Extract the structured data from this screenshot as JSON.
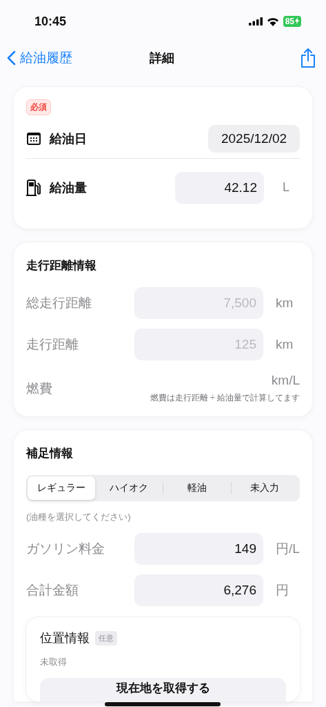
{
  "status_bar": {
    "time": "10:45",
    "battery": "85"
  },
  "nav": {
    "back": "給油履歴",
    "title": "詳細"
  },
  "required_card": {
    "badge": "必須",
    "rows": [
      {
        "kind": "date",
        "label": "給油日",
        "value": "2025/12/02"
      },
      {
        "kind": "amount",
        "label": "給油量",
        "value": "42.12",
        "unit": "L"
      }
    ]
  },
  "distance_card": {
    "title": "走行距離情報",
    "rows": [
      {
        "label": "総走行距離",
        "placeholder": "7,500",
        "unit": "km"
      },
      {
        "label": "走行距離",
        "placeholder": "125",
        "unit": "km"
      }
    ],
    "fuel_economy": {
      "label": "燃費",
      "unit": "km/L",
      "note": "燃費は走行距離 ÷ 給油量で計算してます"
    }
  },
  "extra_card": {
    "title": "補足情報",
    "fuel_types": [
      {
        "label": "レギュラー",
        "selected": true
      },
      {
        "label": "ハイオク",
        "selected": false
      },
      {
        "label": "軽油",
        "selected": false
      },
      {
        "label": "未入力",
        "selected": false
      }
    ],
    "hint": "(油種を選択してください)",
    "rows": [
      {
        "label": "ガソリン料金",
        "value": "149",
        "unit": "円/L"
      },
      {
        "label": "合計金額",
        "value": "6,276",
        "unit": "円"
      }
    ],
    "location": {
      "title": "位置情報",
      "badge": "任意",
      "status": "未取得",
      "button": "現在地を取得する"
    }
  }
}
